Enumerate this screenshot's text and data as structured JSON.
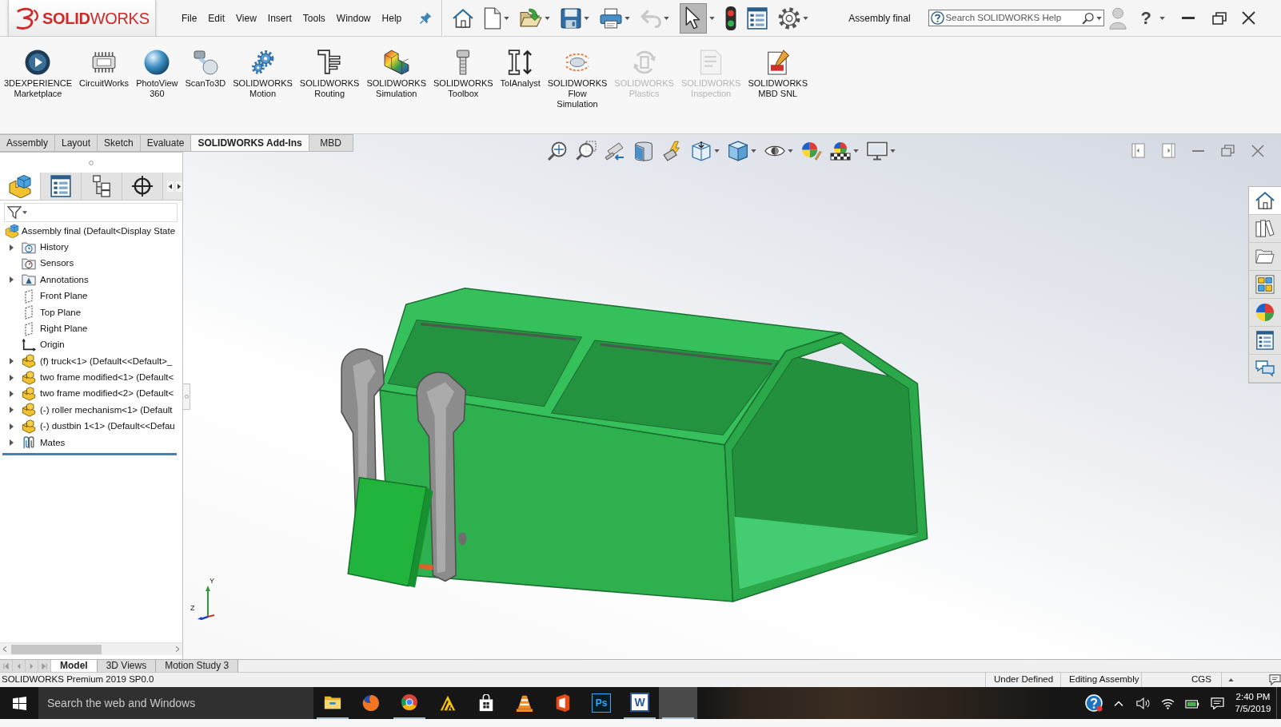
{
  "title_bar": {
    "logo": "**SOLID**WORKS",
    "menu": [
      "File",
      "Edit",
      "View",
      "Insert",
      "Tools",
      "Window",
      "Help"
    ],
    "undo": {
      "disabled": true
    },
    "select": {
      "active": true
    },
    "document_title": "Assembly final",
    "search": {
      "placeholder": "Search SOLIDWORKS Help"
    },
    "help": "?"
  },
  "ribbon": [
    {
      "label": "3DEXPERIENCE Marketplace",
      "disabled": false
    },
    {
      "label": "CircuitWorks",
      "disabled": false
    },
    {
      "label": "PhotoView 360",
      "disabled": false
    },
    {
      "label": "ScanTo3D",
      "disabled": false
    },
    {
      "label": "SOLIDWORKS Motion",
      "disabled": false
    },
    {
      "label": "SOLIDWORKS Routing",
      "disabled": false
    },
    {
      "label": "SOLIDWORKS Simulation",
      "disabled": false
    },
    {
      "label": "SOLIDWORKS Toolbox",
      "disabled": false
    },
    {
      "label": "TolAnalyst",
      "disabled": false
    },
    {
      "label": "SOLIDWORKS Flow Simulation",
      "disabled": false
    },
    {
      "label": "SOLIDWORKS Plastics",
      "disabled": true
    },
    {
      "label": "SOLIDWORKS Inspection",
      "disabled": true
    },
    {
      "label": "SOLIDWORKS MBD SNL",
      "disabled": false
    }
  ],
  "command_tabs": [
    {
      "label": "Assembly",
      "selected": false
    },
    {
      "label": "Layout",
      "selected": false
    },
    {
      "label": "Sketch",
      "selected": false
    },
    {
      "label": "Evaluate",
      "selected": false
    },
    {
      "label": "SOLIDWORKS Add-Ins",
      "selected": true
    },
    {
      "label": "MBD",
      "selected": false
    }
  ],
  "feature_manager": {
    "panel_tabs": [
      {
        "selected": true
      },
      {
        "selected": false
      },
      {
        "selected": false
      },
      {
        "selected": false
      }
    ],
    "tree": {
      "label": "Assembly final (Default<Display State",
      "kind": "assembly",
      "children": [
        {
          "label": "History",
          "kind": "history",
          "expandable": true
        },
        {
          "label": "Sensors",
          "kind": "sensors",
          "expandable": false
        },
        {
          "label": "Annotations",
          "kind": "annotations",
          "expandable": true
        },
        {
          "label": "Front Plane",
          "kind": "plane",
          "expandable": false
        },
        {
          "label": "Top Plane",
          "kind": "plane",
          "expandable": false
        },
        {
          "label": "Right Plane",
          "kind": "plane",
          "expandable": false
        },
        {
          "label": "Origin",
          "kind": "origin",
          "expandable": false
        },
        {
          "label": "(f) truck<1> (Default<<Default>_",
          "kind": "part",
          "expandable": true
        },
        {
          "label": "two frame modified<1> (Default<",
          "kind": "part",
          "expandable": true
        },
        {
          "label": "two frame modified<2> (Default<",
          "kind": "part",
          "expandable": true
        },
        {
          "label": "(-) roller mechanism<1> (Default",
          "kind": "part",
          "expandable": true
        },
        {
          "label": "(-) dustbin 1<1> (Default<<Defau",
          "kind": "part",
          "expandable": true
        },
        {
          "label": "Mates",
          "kind": "mates",
          "expandable": true
        }
      ]
    }
  },
  "graphics_area": {
    "triad": {
      "labels": [
        "Y",
        "Z"
      ]
    },
    "task_pane": [
      {
        "selected": true
      },
      {
        "selected": false
      },
      {
        "selected": false
      },
      {
        "selected": false
      },
      {
        "selected": false
      },
      {
        "selected": false
      },
      {
        "selected": false
      }
    ]
  },
  "bottom_tabs": [
    {
      "label": "Model",
      "selected": true
    },
    {
      "label": "3D Views",
      "selected": false
    },
    {
      "label": "Motion Study 3",
      "selected": false
    }
  ],
  "status_bar": {
    "product": "SOLIDWORKS Premium 2019 SP0.0",
    "items": [
      "Under Defined",
      "Editing Assembly"
    ],
    "units": "CGS"
  },
  "taskbar": {
    "search": {
      "placeholder": "Search the web and Windows"
    },
    "apps": [
      {
        "running": true,
        "selected": false
      },
      {
        "running": false,
        "selected": false
      },
      {
        "running": true,
        "selected": false
      },
      {
        "running": false,
        "selected": false
      },
      {
        "running": false,
        "selected": false
      },
      {
        "running": false,
        "selected": false
      },
      {
        "running": false,
        "selected": false
      },
      {
        "tile": "Ps",
        "running": false,
        "selected": false
      },
      {
        "tile": "W",
        "running": true,
        "selected": false
      },
      {
        "running": true,
        "selected": true
      }
    ],
    "time": "2:40 PM",
    "date": "7/5/2019"
  }
}
